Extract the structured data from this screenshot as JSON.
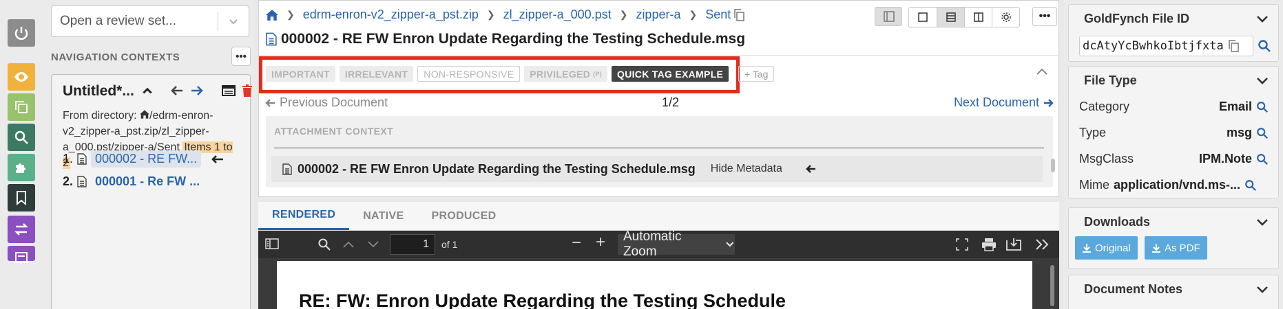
{
  "rail": {
    "items": [
      {
        "name": "power",
        "color": "#8c8c8c"
      },
      {
        "name": "eye",
        "color": "#f0b23a"
      },
      {
        "name": "copy",
        "color": "#98c26b"
      },
      {
        "name": "search",
        "color": "#3c7a63"
      },
      {
        "name": "puzzle",
        "color": "#5bb08a"
      },
      {
        "name": "bookmark",
        "color": "#2f3d3a"
      },
      {
        "name": "transfer",
        "color": "#8a4fc1"
      },
      {
        "name": "list",
        "color": "#8a4fc1"
      }
    ]
  },
  "nav": {
    "review_placeholder": "Open a review set...",
    "contexts_title": "NAVIGATION CONTEXTS",
    "more_label": "•••",
    "context": {
      "title": "Untitled*...",
      "desc_prefix": "From directory: ",
      "desc_path": "/edrm-enron-v2_zipper-a_pst.zip/zl_zipper-a_000.pst/zipper-a/Sent ",
      "highlight": "Items 1 to 2",
      "items": [
        {
          "num": "1.",
          "label": "000002 - RE  FW..."
        },
        {
          "num": "2.",
          "label": "000001 - Re  FW  ..."
        }
      ]
    }
  },
  "center": {
    "breadcrumb": [
      "edrm-enron-v2_zipper-a_pst.zip",
      "zl_zipper-a_000.pst",
      "zipper-a",
      "Sent"
    ],
    "more_label": "•••",
    "doc_title": "000002 - RE  FW  Enron Update Regarding the Testing Schedule.msg",
    "tags": [
      {
        "label": "IMPORTANT",
        "style": "grey",
        "shortcut": ""
      },
      {
        "label": "IRRELEVANT",
        "style": "grey",
        "shortcut": ""
      },
      {
        "label": "NON-RESPONSIVE",
        "style": "outline",
        "shortcut": ""
      },
      {
        "label": "PRIVILEGED",
        "style": "grey",
        "shortcut": "(P)"
      },
      {
        "label": "QUICK TAG EXAMPLE",
        "style": "dark",
        "shortcut": ""
      }
    ],
    "add_tag_label": "+ Tag",
    "prev_label": "Previous Document",
    "counter": "1/2",
    "next_label": "Next Document",
    "attachment_label": "ATTACHMENT CONTEXT",
    "attachment_name": "000002 - RE FW Enron Update Regarding the Testing Schedule.msg",
    "hide_metadata": "Hide Metadata",
    "view_tabs": [
      "RENDERED",
      "NATIVE",
      "PRODUCED"
    ],
    "active_view_tab": "RENDERED",
    "pdf": {
      "page_value": "1",
      "of_pages": "of 1",
      "zoom": "Automatic Zoom",
      "heading": "RE: FW: Enron Update Regarding the Testing Schedule"
    }
  },
  "right": {
    "goldfynch_title": "GoldFynch File ID",
    "file_id": "dcAtyYcBwhkoIbtjfxta",
    "file_type_title": "File Type",
    "fields": [
      {
        "key": "Category",
        "value": "Email"
      },
      {
        "key": "Type",
        "value": "msg"
      },
      {
        "key": "MsgClass",
        "value": "IPM.Note"
      },
      {
        "key": "Mime",
        "value": "application/vnd.ms-..."
      }
    ],
    "downloads_title": "Downloads",
    "download_original": "Original",
    "download_pdf": "As PDF",
    "notes_title": "Document Notes"
  },
  "colors": {
    "link": "#2a64ad",
    "highlight_frame": "#e12d1c",
    "download_button": "#5ba8dc"
  }
}
